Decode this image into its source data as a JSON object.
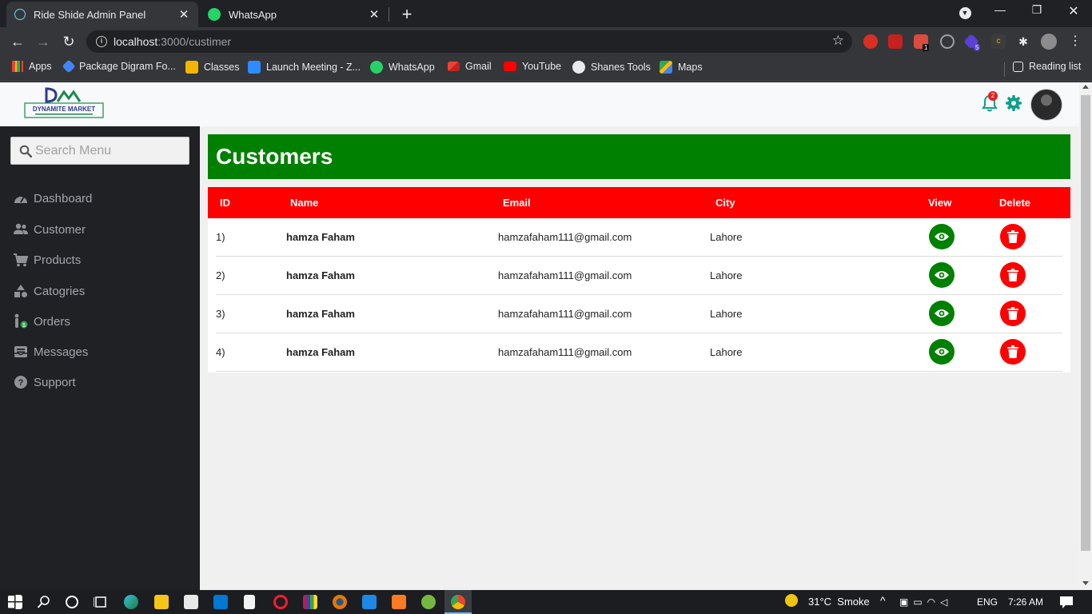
{
  "browser": {
    "tabs": [
      {
        "title": "Ride Shide Admin Panel",
        "active": true
      },
      {
        "title": "WhatsApp",
        "active": false
      }
    ],
    "url": {
      "host": "localhost",
      "path": ":3000/custimer"
    },
    "bookmarks": [
      "Apps",
      "Package Digram Fo...",
      "Classes",
      "Launch Meeting - Z...",
      "WhatsApp",
      "Gmail",
      "YouTube",
      "Shanes Tools",
      "Maps"
    ],
    "reading_list": "Reading list",
    "extension_badges": {
      "todoist": "1",
      "hat": "5"
    }
  },
  "header": {
    "logo_text": "DYNAMITE MARKET",
    "notification_count": "2"
  },
  "sidebar": {
    "search_placeholder": "Search Menu",
    "items": [
      {
        "label": "Dashboard",
        "icon": "dashboard-icon"
      },
      {
        "label": "Customer",
        "icon": "users-icon"
      },
      {
        "label": "Products",
        "icon": "cart-icon"
      },
      {
        "label": "Catogries",
        "icon": "shapes-icon"
      },
      {
        "label": "Orders",
        "icon": "orders-icon"
      },
      {
        "label": "Messages",
        "icon": "inbox-icon"
      },
      {
        "label": "Support",
        "icon": "help-icon"
      }
    ]
  },
  "page": {
    "title": "Customers",
    "columns": [
      "ID",
      "Name",
      "Email",
      "City",
      "View",
      "Delete"
    ],
    "rows": [
      {
        "id": "1)",
        "name": "hamza Faham",
        "email": "hamzafaham111@gmail.com",
        "city": "Lahore"
      },
      {
        "id": "2)",
        "name": "hamza Faham",
        "email": "hamzafaham111@gmail.com",
        "city": "Lahore"
      },
      {
        "id": "3)",
        "name": "hamza Faham",
        "email": "hamzafaham111@gmail.com",
        "city": "Lahore"
      },
      {
        "id": "4)",
        "name": "hamza Faham",
        "email": "hamzafaham111@gmail.com",
        "city": "Lahore"
      }
    ]
  },
  "taskbar": {
    "weather": "31°C  Smoke",
    "language": "ENG",
    "time": "7:26 AM"
  },
  "colors": {
    "accent_green": "#008000",
    "accent_red": "#ff0000",
    "sidebar_bg": "#1f2125",
    "teal_icon": "#0e9f8a"
  }
}
